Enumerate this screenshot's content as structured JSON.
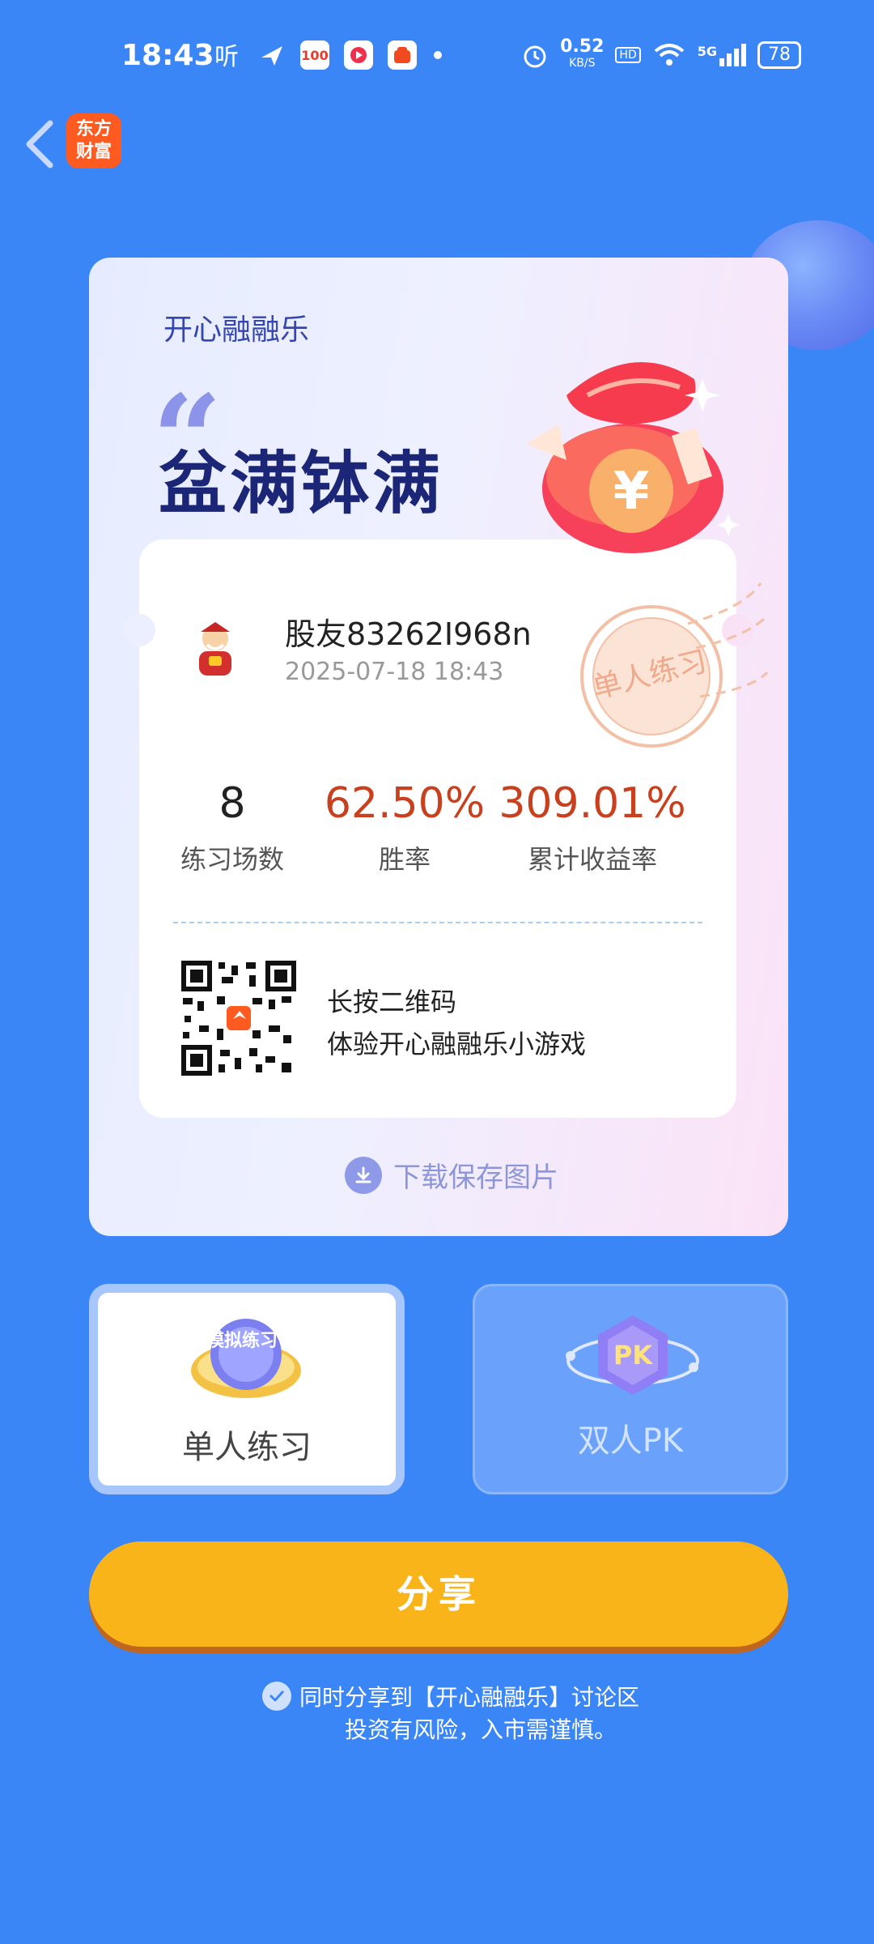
{
  "status_bar": {
    "time": "18:43",
    "app_icon_text": "100",
    "network_speed": "0.52",
    "network_unit": "KB/S",
    "hd": "HD",
    "signal": "5G",
    "battery": "78"
  },
  "header": {
    "logo_line1": "东方",
    "logo_line2": "财富"
  },
  "card": {
    "brand": "开心融融乐",
    "quote_mark": "“",
    "headline": "盆满钵满",
    "user_name": "股友83262I968n",
    "timestamp": "2025-07-18 18:43",
    "stamp_text": "单人练习",
    "stats": [
      {
        "value": "8",
        "label": "练习场数"
      },
      {
        "value": "62.50%",
        "label": "胜率"
      },
      {
        "value": "309.01%",
        "label": "累计收益率"
      }
    ],
    "qr_line1": "长按二维码",
    "qr_line2": "体验开心融融乐小游戏",
    "download_label": "下载保存图片"
  },
  "modes": {
    "single_label": "单人练习",
    "single_badge": "模拟练习",
    "pk_label": "双人PK",
    "pk_badge": "PK"
  },
  "share_button": "分享",
  "share_option": "同时分享到【开心融融乐】讨论区",
  "risk_notice": "投资有风险，入市需谨慎。",
  "colors": {
    "background": "#3a86f7",
    "stat_accent": "#c8401e",
    "share_button": "#f9b41a"
  }
}
